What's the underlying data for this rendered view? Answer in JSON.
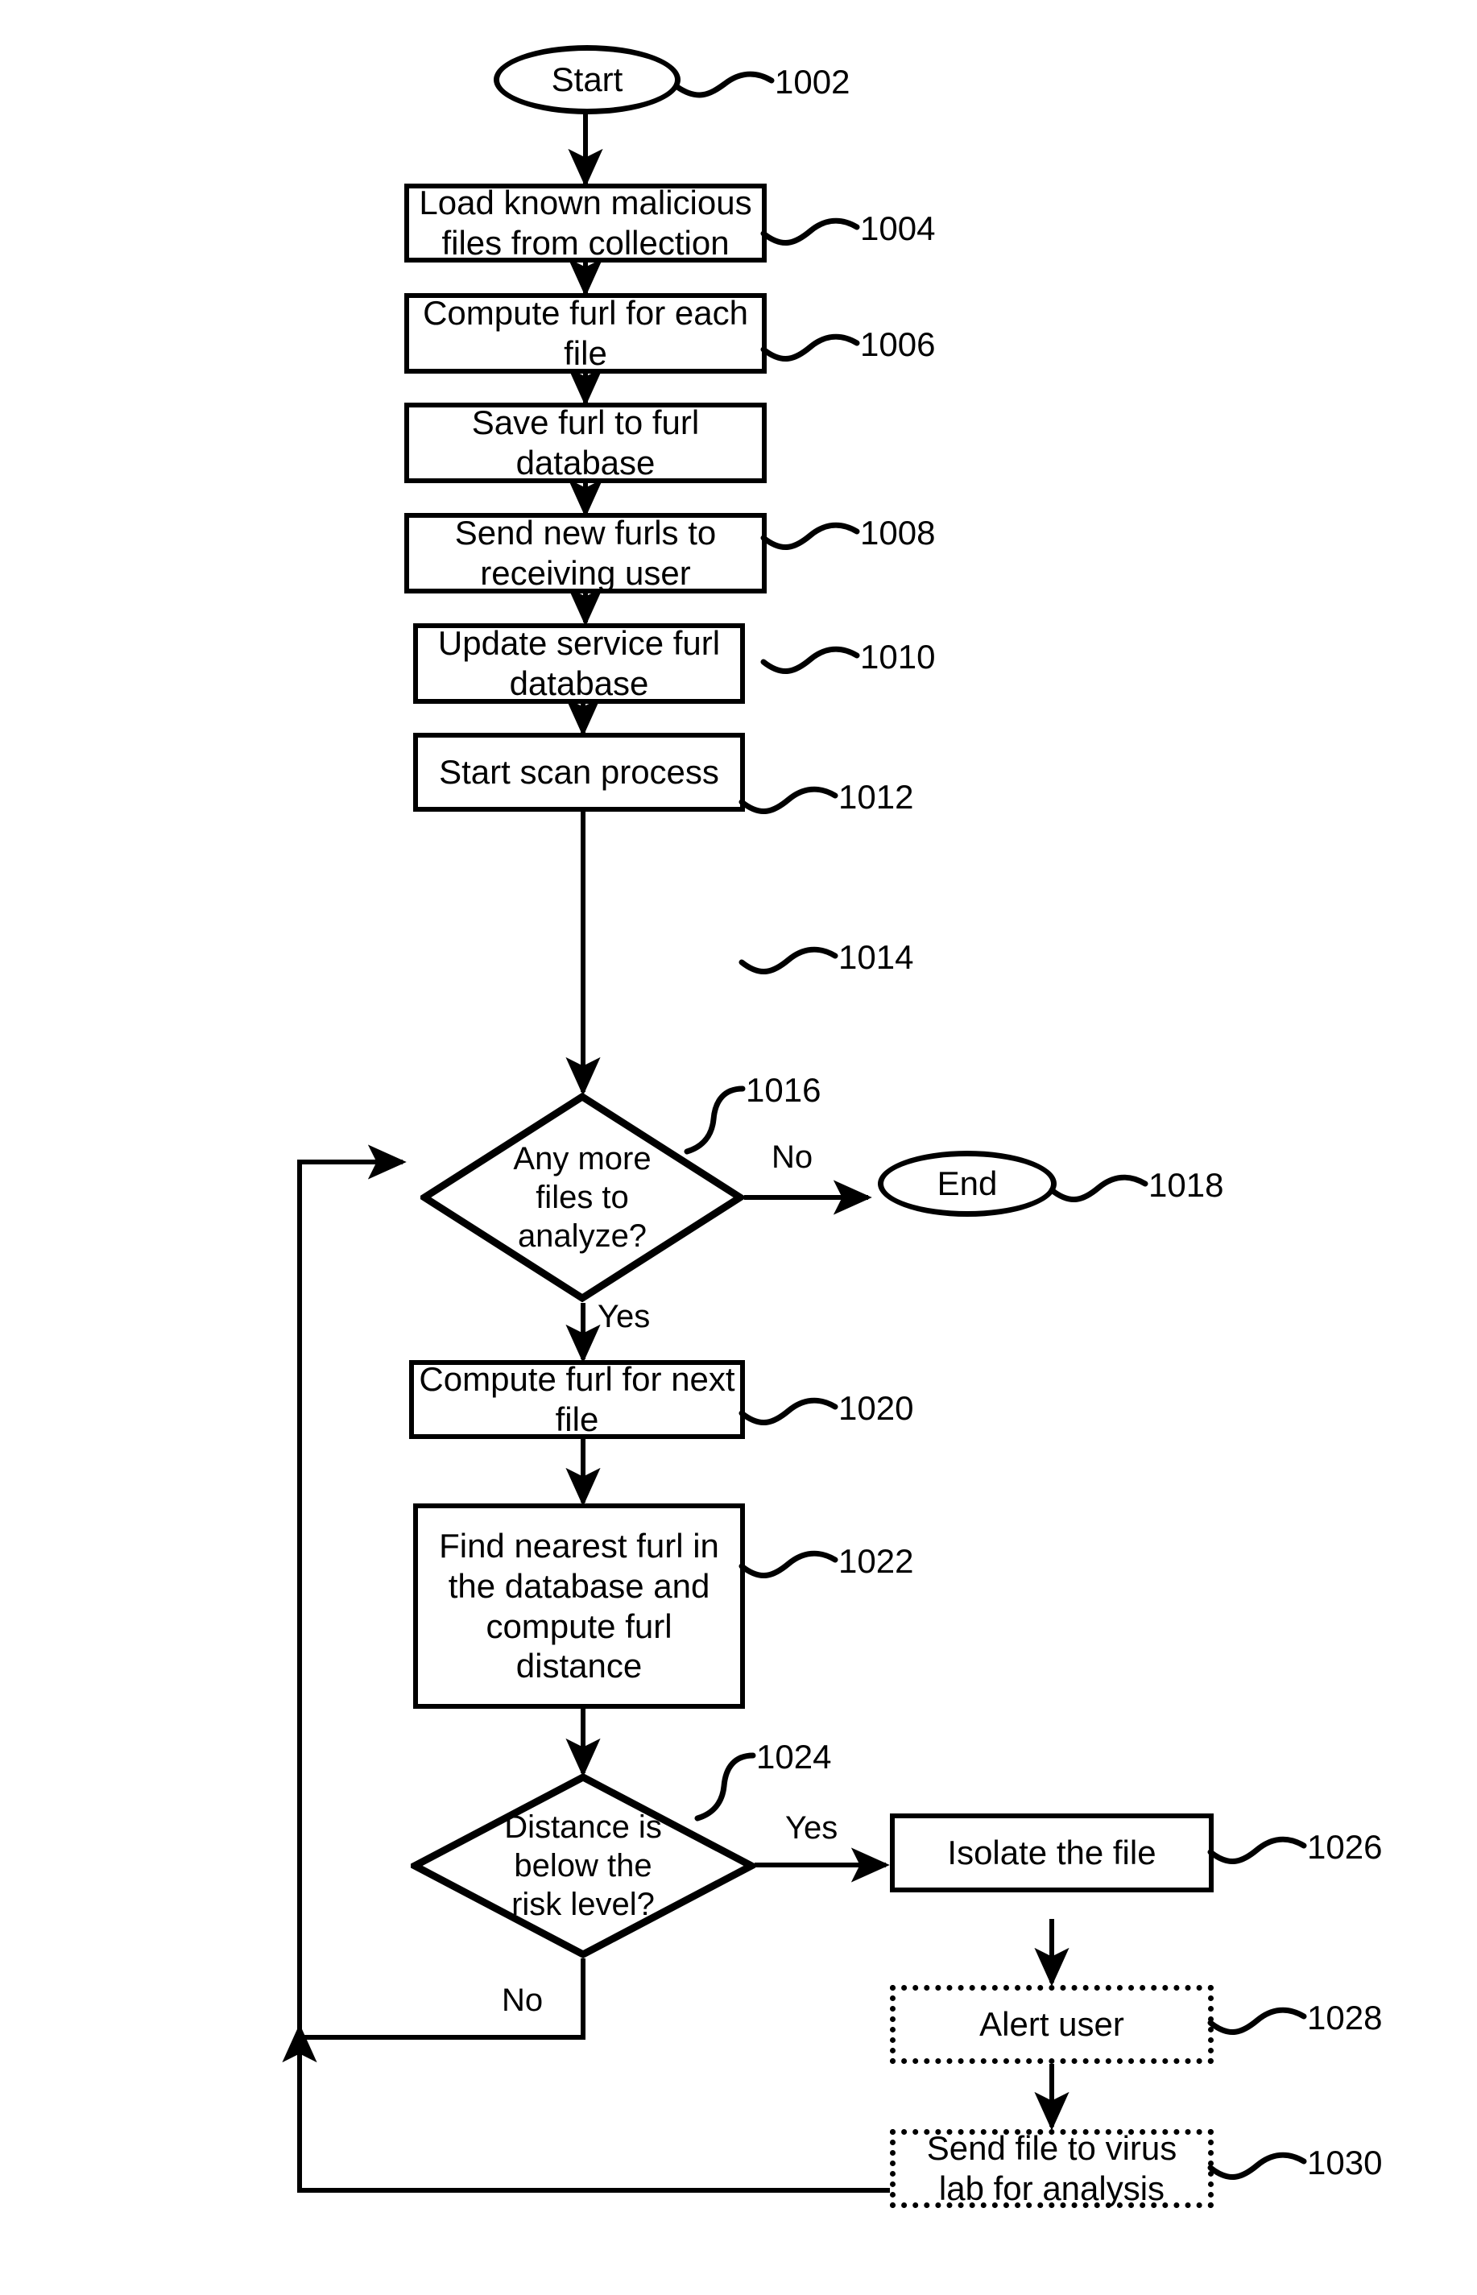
{
  "diagram": {
    "title": "Malicious file furl scanning process flowchart",
    "stroke_color": "#000000",
    "background_color": "#ffffff"
  },
  "nodes": {
    "start": {
      "label": "Start",
      "shape": "terminator",
      "ref": "1002"
    },
    "load_files": {
      "label": "Load known malicious files from collection",
      "shape": "process",
      "ref": "1004"
    },
    "compute_furl_each": {
      "label": "Compute furl for each file",
      "shape": "process",
      "ref": "1006"
    },
    "save_furl": {
      "label": "Save furl to furl database",
      "shape": "process",
      "ref": "1008"
    },
    "send_furls": {
      "label": "Send new furls to receiving user",
      "shape": "process",
      "ref": "1010"
    },
    "update_service_db": {
      "label": "Update service furl database",
      "shape": "process",
      "ref": "1012"
    },
    "start_scan": {
      "label": "Start scan process",
      "shape": "process",
      "ref": "1014"
    },
    "any_more_files": {
      "label": "Any more files to analyze?",
      "shape": "decision",
      "ref": "1016"
    },
    "end": {
      "label": "End",
      "shape": "terminator",
      "ref": "1018"
    },
    "compute_furl_next": {
      "label": "Compute furl for next file",
      "shape": "process",
      "ref": "1020"
    },
    "find_nearest": {
      "label": "Find nearest furl in the database and compute furl distance",
      "shape": "process",
      "ref": "1022"
    },
    "distance_below_risk": {
      "label": "Distance is below the risk level?",
      "shape": "decision",
      "ref": "1024"
    },
    "isolate_file": {
      "label": "Isolate the file",
      "shape": "process",
      "ref": "1026"
    },
    "alert_user": {
      "label": "Alert user",
      "shape": "process-dotted",
      "ref": "1028"
    },
    "send_virus_lab": {
      "label": "Send file to virus lab for analysis",
      "shape": "process-dotted",
      "ref": "1030"
    }
  },
  "edge_labels": {
    "any_more_no": "No",
    "any_more_yes": "Yes",
    "distance_yes": "Yes",
    "distance_no": "No"
  },
  "reference_numerals": {
    "n1002": "1002",
    "n1004": "1004",
    "n1006": "1006",
    "n1008": "1008",
    "n1010": "1010",
    "n1012": "1012",
    "n1014": "1014",
    "n1016": "1016",
    "n1018": "1018",
    "n1020": "1020",
    "n1022": "1022",
    "n1024": "1024",
    "n1026": "1026",
    "n1028": "1028",
    "n1030": "1030"
  }
}
